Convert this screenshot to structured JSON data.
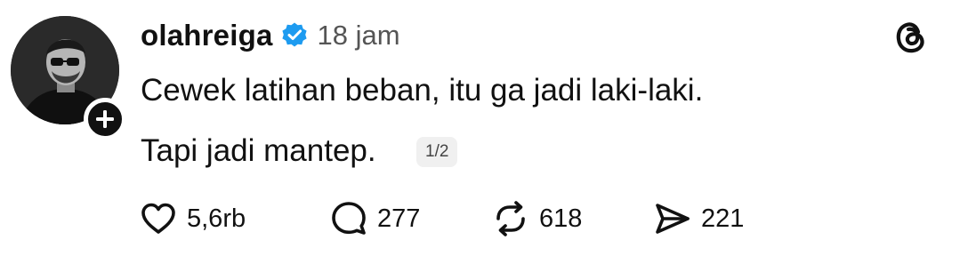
{
  "post": {
    "username": "olahreiga",
    "time": "18 jam",
    "text_line1": "Cewek latihan beban, itu ga jadi laki-laki.",
    "text_line2": "Tapi jadi mantep.",
    "pager": "1/2"
  },
  "actions": {
    "likes": "5,6rb",
    "replies": "277",
    "reposts": "618",
    "shares": "221"
  },
  "icons": {
    "verified": "verified-badge-icon",
    "follow": "plus-icon",
    "brand": "threads-logo-icon",
    "like": "heart-icon",
    "reply": "speech-bubble-icon",
    "repost": "repost-icon",
    "share": "send-icon"
  },
  "colors": {
    "verified_blue": "#1d9bf0",
    "text": "#111111",
    "muted": "#555555"
  }
}
